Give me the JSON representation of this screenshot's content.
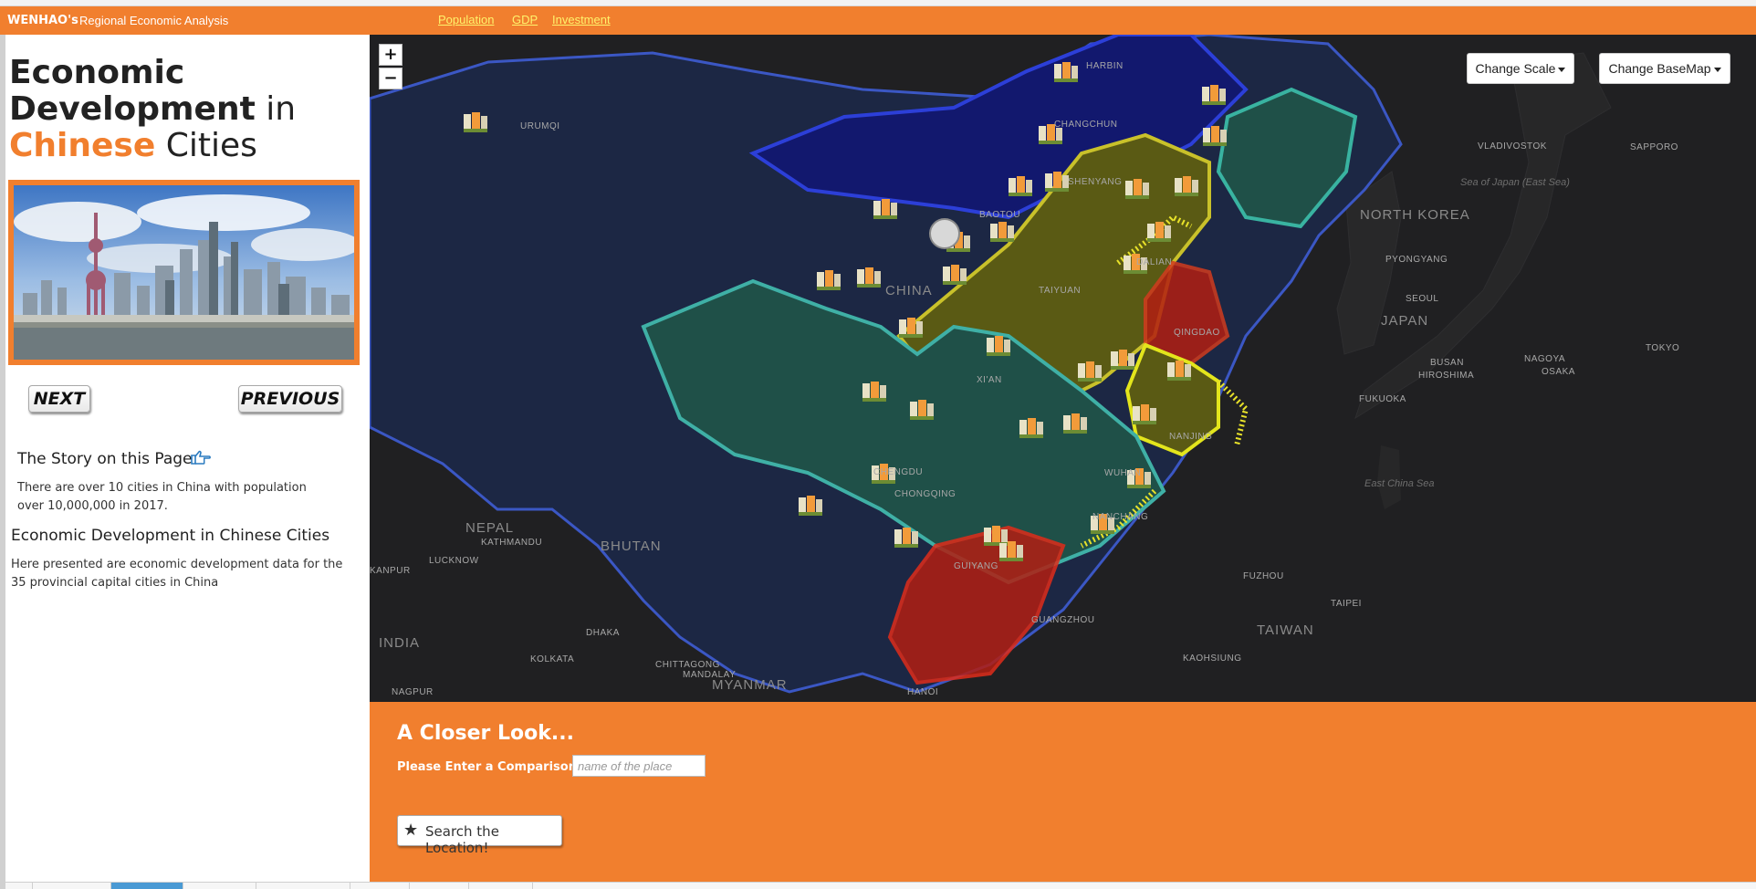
{
  "header": {
    "brand": "WENHAO's",
    "subtitle": "Regional Economic Analysis",
    "links": [
      "Population",
      "GDP",
      "Investment"
    ]
  },
  "sidebar": {
    "title_part1": "Economic",
    "title_part2": "Development",
    "title_part3": "in",
    "title_part4": "Chinese",
    "title_part5": "Cities",
    "next_label": "NEXT",
    "previous_label": "PREVIOUS",
    "story_heading": "The Story on this Page",
    "story_text": "There are over 10 cities in China with population over 10,000,000 in 2017.",
    "section_heading": "Economic Development in Chinese Cities",
    "section_text": "Here presented are economic development data for the 35 provincial capital cities in China"
  },
  "map": {
    "zoom_in": "+",
    "zoom_out": "−",
    "change_scale": "Change Scale",
    "change_basemap": "Change BaseMap",
    "countries": [
      {
        "name": "NORTH KOREA"
      },
      {
        "name": "JAPAN"
      },
      {
        "name": "TAIWAN"
      },
      {
        "name": "NEPAL"
      },
      {
        "name": "BHUTAN"
      },
      {
        "name": "INDIA"
      },
      {
        "name": "MYANMAR"
      },
      {
        "name": "CHINA"
      }
    ],
    "seas": [
      "Sea of Japan (East Sea)",
      "East China Sea"
    ],
    "cities": [
      "URUMQI",
      "HARBIN",
      "CHANGCHUN",
      "SHENYANG",
      "BAOTOU",
      "TAIYUAN",
      "DALIAN",
      "QINGDAO",
      "XI'AN",
      "CHENGDU",
      "CHONGQING",
      "WUHAN",
      "NANJING",
      "NANCHANG",
      "GUIYANG",
      "GUANGZHOU",
      "FUZHOU",
      "VLADIVOSTOK",
      "SAPPORO",
      "PYONGYANG",
      "SEOUL",
      "BUSAN",
      "NAGOYA",
      "OSAKA",
      "TOKYO",
      "HIROSHIMA",
      "FUKUOKA",
      "TAIPEI",
      "KAOHSIUNG",
      "HANOI",
      "DHAKA",
      "KOLKATA",
      "CHITTAGONG",
      "MANDALAY",
      "KATHMANDU",
      "LUCKNOW",
      "KANPUR",
      "NAGPUR"
    ],
    "colors": {
      "red": "#b21e12",
      "olive": "#5a5a14",
      "teal": "#1f5048",
      "navy": "#12186e",
      "blue_dark": "#1c2744"
    }
  },
  "panel": {
    "title": "A Closer Look...",
    "label": "Please Enter a Comparison",
    "input_placeholder": "name of the place",
    "input_value": "",
    "search_button": "Search the Location!",
    "search_icon": "star-icon"
  },
  "theme": {
    "accent": "#f17f2e",
    "link": "#fff36b"
  }
}
